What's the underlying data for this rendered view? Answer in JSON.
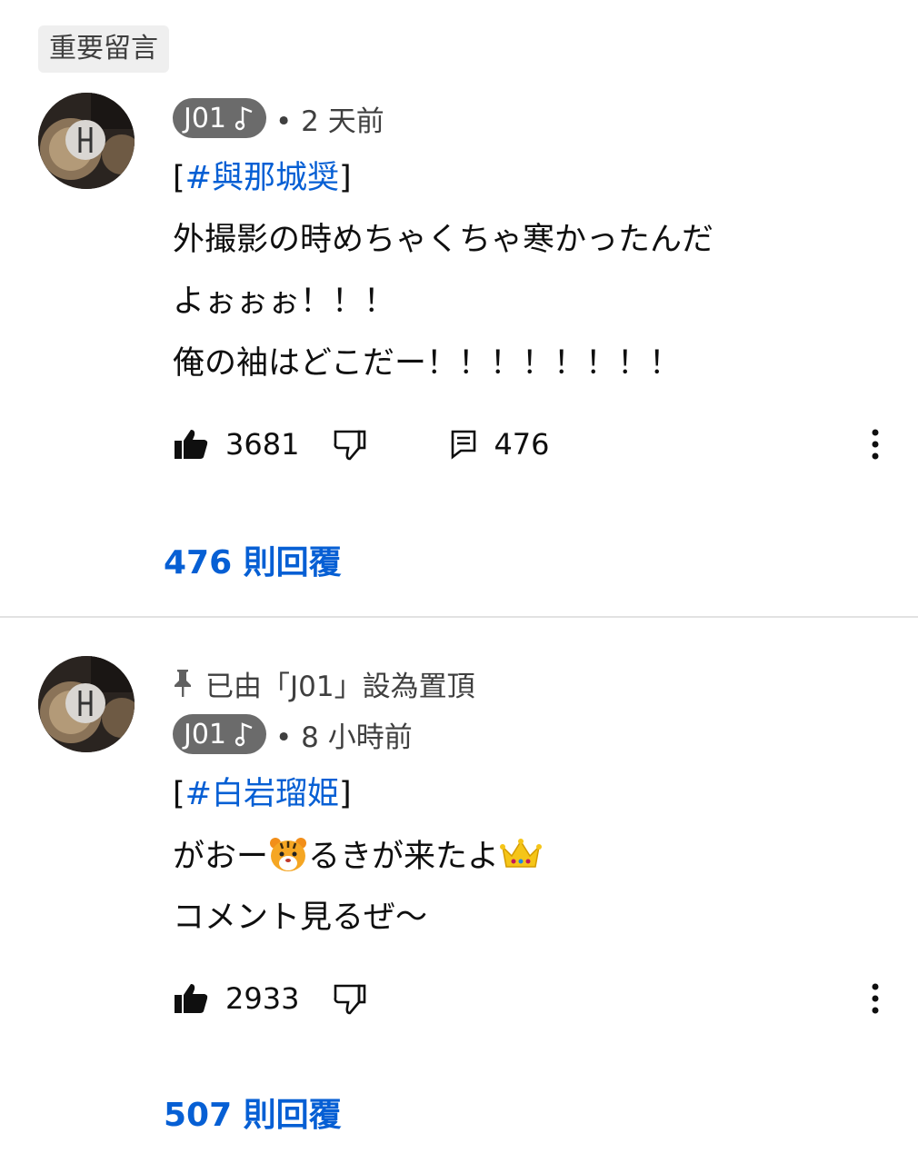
{
  "filter_chip": "重要留言",
  "comments": [
    {
      "author": "J01",
      "time": "• 2 天前",
      "hashtag": "#與那城奨",
      "lines": [
        "外撮影の時めちゃくちゃ寒かったんだ",
        "よぉぉぉ！！！",
        "俺の袖はどこだー！！！！！！！！"
      ],
      "likes": "3681",
      "reply_count_inline": "476",
      "replies_link": "476 則回覆"
    },
    {
      "pinned_text": "已由「J01」設為置頂",
      "author": "J01",
      "time": "• 8 小時前",
      "hashtag": "#白岩瑠姫",
      "line1_a": "がおー",
      "line1_b": "るきが来たよ",
      "line2": "コメント見るぜ〜",
      "likes": "2933",
      "replies_link": "507 則回覆"
    }
  ],
  "icons": [
    "music-note-icon",
    "thumbs-up-icon",
    "thumbs-down-icon",
    "comment-icon",
    "more-vert-icon",
    "pin-icon",
    "tiger-emoji",
    "crown-emoji"
  ],
  "colors": {
    "link": "#065fd4",
    "author_pill": "#6b6b6b",
    "chip_bg": "#efefef"
  }
}
